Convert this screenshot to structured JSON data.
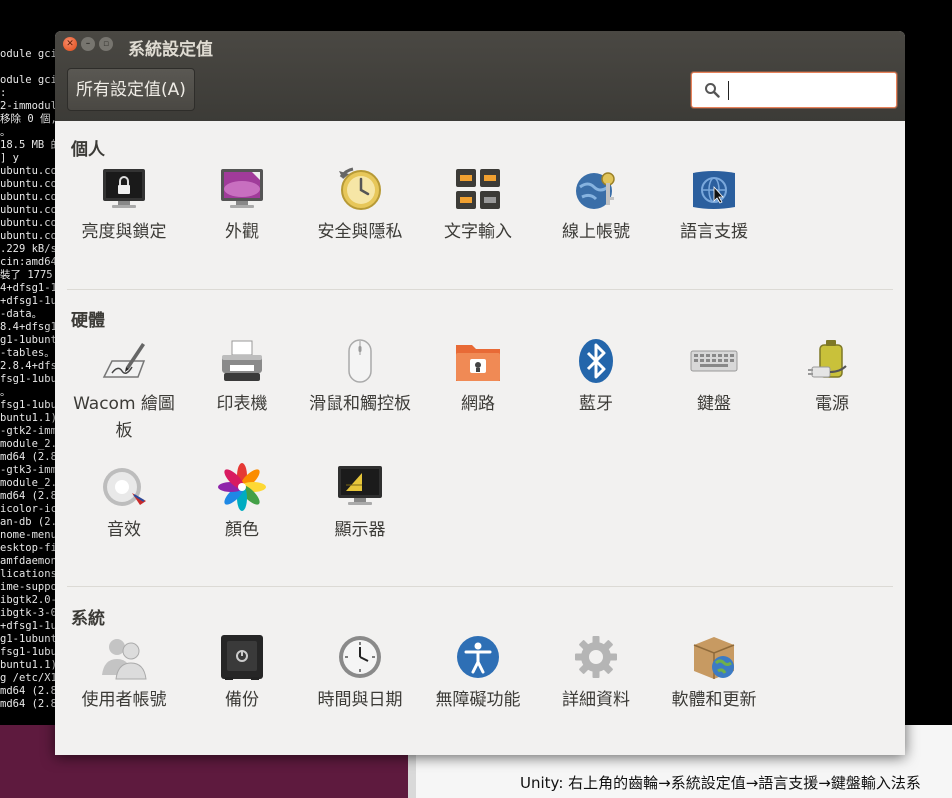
{
  "terminal": {
    "lines": [
      "odule gci",
      "",
      "odule gci",
      ":",
      "2-immodul",
      "移除 0 個,",
      "。",
      "18.5 MB 的",
      "] y",
      "ubuntu.co",
      "ubuntu.co",
      "ubuntu.co",
      "ubuntu.co",
      "ubuntu.co",
      "ubuntu.co",
      ".229 kB/s",
      "cin:amd64",
      "裝了 1775",
      "4+dfsg1-1",
      "+dfsg1-1u",
      "-data。",
      "8.4+dfsg1",
      "g1-1ubunt",
      "-tables。",
      "2.8.4+dfs",
      "fsg1-1ubu",
      "。",
      "fsg1-1ubu",
      "buntu1.1)",
      "-gtk2-imm",
      "module_2.",
      "md64 (2.8",
      "-gtk3-imm",
      "module_2.",
      "md64 (2.8",
      "icolor-ic",
      "an-db (2.",
      "nome-menu",
      "esktop-fi",
      "amfdaemon",
      "lications",
      "ime-suppo",
      "ibgtk2.0-",
      "ibgtk-3-0",
      "+dfsg1-1u",
      "g1-1ubunt",
      "fsg1-1ubu",
      "buntu1.1)",
      "g /etc/X1",
      "md64 (2.8",
      "md64 (2.8"
    ]
  },
  "caption": "Unity: 右上角的齒輪→系統設定值→語言支援→鍵盤輸入法系",
  "window": {
    "title": "系統設定值",
    "all_settings_label": "所有設定值(A)",
    "search": {
      "value": "",
      "placeholder": ""
    }
  },
  "sections": {
    "personal": {
      "title": "個人",
      "items": [
        {
          "label": "亮度與鎖定",
          "icon": "brightness-lock-icon"
        },
        {
          "label": "外觀",
          "icon": "appearance-icon"
        },
        {
          "label": "安全與隱私",
          "icon": "security-privacy-icon"
        },
        {
          "label": "文字輸入",
          "icon": "text-entry-icon"
        },
        {
          "label": "線上帳號",
          "icon": "online-accounts-icon"
        },
        {
          "label": "語言支援",
          "icon": "language-support-icon"
        }
      ]
    },
    "hardware": {
      "title": "硬體",
      "items": [
        {
          "label": "Wacom 繪圖板",
          "icon": "wacom-tablet-icon"
        },
        {
          "label": "印表機",
          "icon": "printer-icon"
        },
        {
          "label": "滑鼠和觸控板",
          "icon": "mouse-touchpad-icon"
        },
        {
          "label": "網路",
          "icon": "network-icon"
        },
        {
          "label": "藍牙",
          "icon": "bluetooth-icon"
        },
        {
          "label": "鍵盤",
          "icon": "keyboard-icon"
        },
        {
          "label": "電源",
          "icon": "power-icon"
        },
        {
          "label": "音效",
          "icon": "sound-icon"
        },
        {
          "label": "顏色",
          "icon": "color-icon"
        },
        {
          "label": "顯示器",
          "icon": "displays-icon"
        }
      ]
    },
    "system": {
      "title": "系統",
      "items": [
        {
          "label": "使用者帳號",
          "icon": "user-accounts-icon"
        },
        {
          "label": "備份",
          "icon": "backup-icon"
        },
        {
          "label": "時間與日期",
          "icon": "time-date-icon"
        },
        {
          "label": "無障礙功能",
          "icon": "accessibility-icon"
        },
        {
          "label": "詳細資料",
          "icon": "details-icon"
        },
        {
          "label": "軟體和更新",
          "icon": "software-updates-icon"
        }
      ]
    }
  },
  "colors": {
    "titlebar": "#3c3b37",
    "panel_bg": "#f2f1f0",
    "accent": "#e9825a",
    "text": "#3c3b37"
  }
}
